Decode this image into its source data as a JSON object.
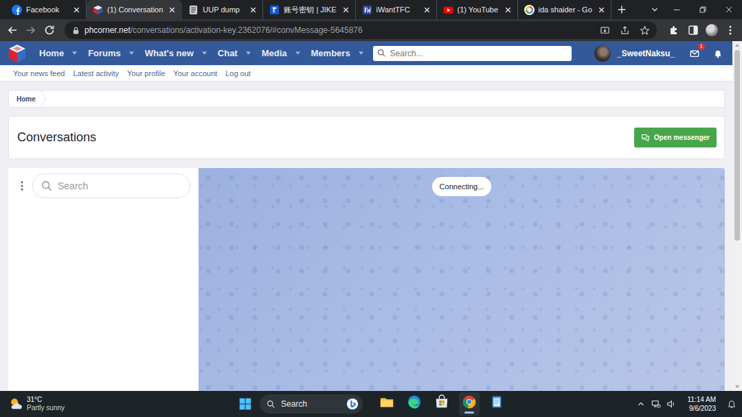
{
  "browser": {
    "tabs": [
      {
        "label": "Facebook",
        "selected": false
      },
      {
        "label": "(1) Conversation",
        "selected": true
      },
      {
        "label": "UUP dump",
        "selected": false
      },
      {
        "label": "账号密钥 | JIKE",
        "selected": false
      },
      {
        "label": "iWantTFC",
        "selected": false
      },
      {
        "label": "(1) YouTube",
        "selected": false
      },
      {
        "label": "ida shaider - Go",
        "selected": false
      }
    ],
    "url": {
      "host": "phcorner.net",
      "path": "/conversations/activation-key.2362076/#convMessage-5645876"
    }
  },
  "site": {
    "nav": [
      {
        "label": "Home"
      },
      {
        "label": "Forums"
      },
      {
        "label": "What's new"
      },
      {
        "label": "Chat"
      },
      {
        "label": "Media"
      },
      {
        "label": "Members"
      }
    ],
    "search": {
      "placeholder": "Search..."
    },
    "user": {
      "name": "_SweetNaksu_"
    },
    "inbox_badge": "1",
    "subnav": [
      "Your news feed",
      "Latest activity",
      "Your profile",
      "Your account",
      "Log out"
    ]
  },
  "breadcrumb": [
    "Home"
  ],
  "page": {
    "title": "Conversations",
    "button": "Open messenger"
  },
  "messenger": {
    "search": {
      "placeholder": "Search"
    },
    "status": "Connecting..."
  },
  "taskbar": {
    "weather": {
      "temperature": "31°C",
      "condition": "Partly sunny"
    },
    "search": {
      "placeholder": "Search"
    },
    "apps": [
      {
        "active": false
      },
      {
        "active": false
      },
      {
        "active": false
      },
      {
        "active": true
      },
      {
        "active": false
      }
    ],
    "time": "11:14 AM",
    "date": "9/6/2023"
  }
}
